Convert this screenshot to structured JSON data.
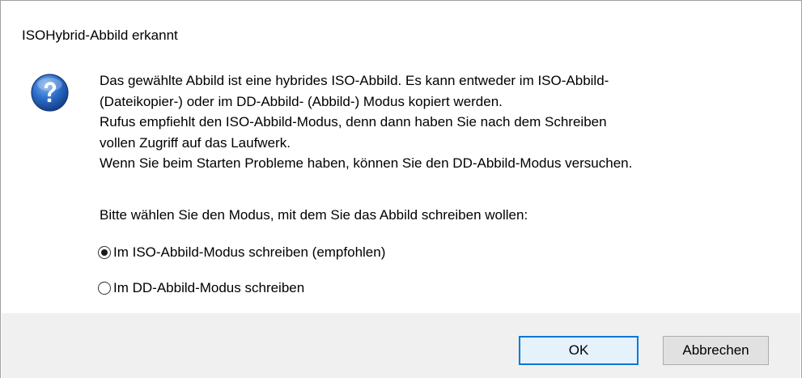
{
  "dialog": {
    "title": "ISOHybrid-Abbild erkannt",
    "icon": "question-icon",
    "message_lines": [
      "Das gewählte Abbild ist eine hybrides ISO-Abbild. Es kann entweder im ISO-Abbild-",
      "(Dateikopier-) oder im DD-Abbild- (Abbild-) Modus kopiert werden.",
      "Rufus empfiehlt den ISO-Abbild-Modus, denn dann haben Sie nach dem Schreiben",
      "vollen Zugriff auf das Laufwerk.",
      "Wenn Sie beim Starten Probleme haben, können Sie den DD-Abbild-Modus versuchen."
    ],
    "prompt": "Bitte wählen Sie den Modus, mit dem Sie das Abbild schreiben wollen:",
    "options": [
      {
        "label": "Im ISO-Abbild-Modus schreiben (empfohlen)",
        "selected": true
      },
      {
        "label": "Im DD-Abbild-Modus schreiben",
        "selected": false
      }
    ],
    "buttons": {
      "ok_label": "OK",
      "cancel_label": "Abbrechen"
    }
  },
  "colors": {
    "icon_blue": "#1f5fb8",
    "footer_bg": "#f0f0f0",
    "default_button_border": "#0078d7"
  }
}
